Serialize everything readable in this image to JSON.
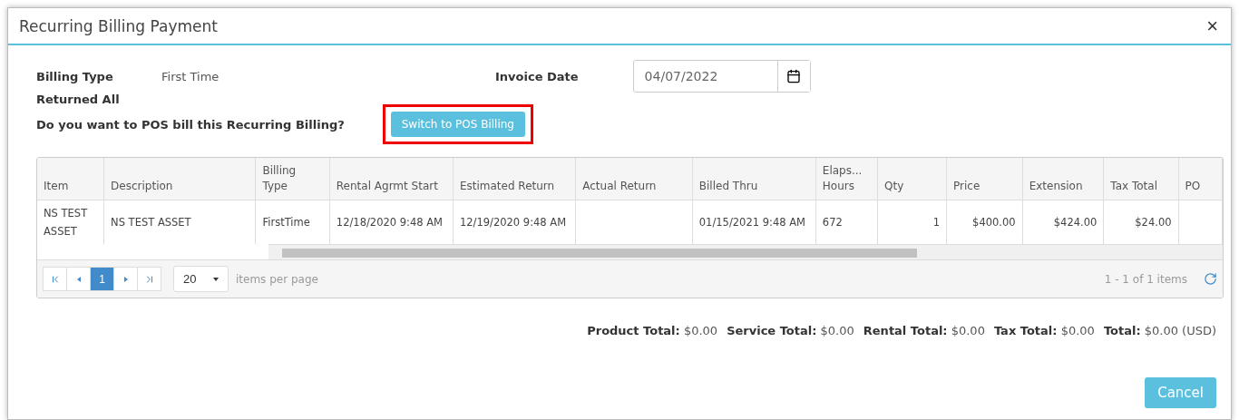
{
  "window": {
    "title": "Recurring Billing Payment",
    "close": "×"
  },
  "billing_type": {
    "label": "Billing Type",
    "value": "First Time"
  },
  "invoice_date": {
    "label": "Invoice Date",
    "value": "04/07/2022"
  },
  "returned": "Returned All",
  "question": "Do you want to POS bill this Recurring Billing?",
  "switch_button": {
    "label": "Switch to POS Billing",
    "highlighted": true
  },
  "table": {
    "columns": [
      "Item",
      "Description",
      "Billing Type",
      "Rental Agrmt Start",
      "Estimated Return",
      "Actual Return",
      "Billed Thru",
      "Elaps... Hours",
      "Qty",
      "Price",
      "Extension",
      "Tax Total",
      "PO"
    ],
    "rows": [
      [
        "NS TEST ASSET",
        "NS TEST ASSET",
        "FirstTime",
        "12/18/2020 9:48 AM",
        "12/19/2020 9:48 AM",
        "",
        "01/15/2021 9:48 AM",
        "672",
        "1",
        "$400.00",
        "$424.00",
        "$24.00",
        ""
      ]
    ]
  },
  "pager": {
    "pages": [
      {
        "label": "1",
        "selected": true
      }
    ],
    "page_size": "20",
    "page_size_label": "items per page",
    "info": "1 - 1 of 1 items"
  },
  "totals": [
    "**Product Total:** $0.00",
    "**Service Total:** $0.00",
    "**Rental Total:** $0.00",
    "**Tax Total:** $0.00",
    "**Total:** $0.00 (USD)"
  ],
  "buttons": [
    "Cancel"
  ]
}
